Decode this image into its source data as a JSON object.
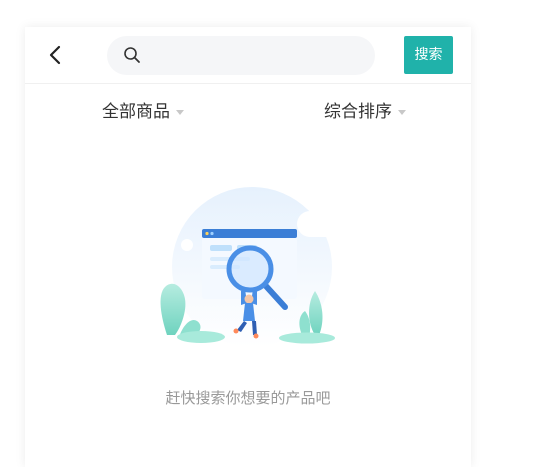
{
  "search": {
    "placeholder": "",
    "button_label": "搜索"
  },
  "filters": {
    "all_goods": "全部商品",
    "sort": "综合排序"
  },
  "empty_state": {
    "message": "赶快搜索你想要的产品吧"
  },
  "colors": {
    "accent": "#20b2aa",
    "search_bg": "#f5f6f8",
    "text_muted": "#999999"
  },
  "icons": {
    "back": "chevron-left-icon",
    "search": "search-icon",
    "caret": "caret-down-icon"
  }
}
